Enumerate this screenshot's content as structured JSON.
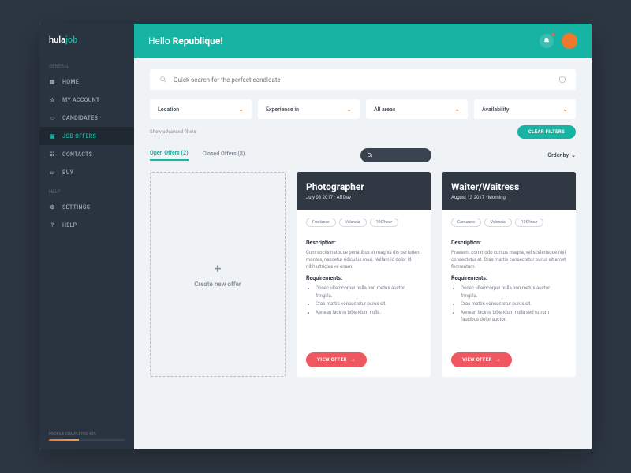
{
  "brand": {
    "part1": "hula",
    "part2": "job"
  },
  "sidebar": {
    "sections": [
      {
        "label": "General",
        "items": [
          {
            "label": "HOME",
            "icon": "grid-icon"
          },
          {
            "label": "MY ACCOUNT",
            "icon": "star-icon"
          },
          {
            "label": "CANDIDATES",
            "icon": "users-icon"
          },
          {
            "label": "JOB OFFERS",
            "icon": "briefcase-icon",
            "active": true
          },
          {
            "label": "CONTACTS",
            "icon": "contacts-icon"
          },
          {
            "label": "BUY",
            "icon": "card-icon"
          }
        ]
      },
      {
        "label": "Help",
        "items": [
          {
            "label": "SETTINGS",
            "icon": "gear-icon"
          },
          {
            "label": "HELP",
            "icon": "help-icon"
          }
        ]
      }
    ],
    "profile": {
      "label": "PROFILE COMPLETED 40%",
      "pct": 40
    }
  },
  "header": {
    "greeting_pre": "Hello ",
    "name": "Republique",
    "bang": "!"
  },
  "search": {
    "placeholder": "Quick search for the perfect candidate"
  },
  "filters": [
    {
      "label": "Location"
    },
    {
      "label": "Experience in"
    },
    {
      "label": "All areas"
    },
    {
      "label": "Availability"
    }
  ],
  "advanced_label": "Show advanced filters",
  "clear_label": "CLEAR FILTERS",
  "tabs": [
    {
      "label": "Open Offers (2)",
      "active": true
    },
    {
      "label": "Closed Offers (8)"
    }
  ],
  "order_label": "Order by",
  "create_label": "Create new offer",
  "offers": [
    {
      "title": "Photographer",
      "subtitle": "July 03 2017 · All Day",
      "tags": [
        "Freelance",
        "Valencia",
        "10€/hour"
      ],
      "desc_h": "Description:",
      "description": "Cum sociis natoque penatibus et magnis dis parturient montes, nascetur ridiculus mus. Nullam id dolor id nibh ultricies ve enam.",
      "req_h": "Requirements:",
      "requirements": [
        "Donec ullamcorper nulla non metus auctor fringilla.",
        "Cras mattis consectetur purus sit.",
        "Aenean lacinia bibendum nulla."
      ],
      "cta": "VIEW OFFER"
    },
    {
      "title": "Waiter/Waitress",
      "subtitle": "August 13 2017 · Morning",
      "tags": [
        "Camarero",
        "Valencia",
        "10€/hour"
      ],
      "desc_h": "Description:",
      "description": "Praesent commodo cursus magna, vel scelerisque nisl consectetur et. Cras mattis consectetur purus sit amet fermentum.",
      "req_h": "Requirements:",
      "requirements": [
        "Donec ullamcorper nulla non metus auctor fringilla.",
        "Cras mattis consectetur purus sit.",
        "Aenean lacinia bibendum nulla sed rutrum faucibus dolor auctor."
      ],
      "cta": "VIEW OFFER"
    }
  ]
}
